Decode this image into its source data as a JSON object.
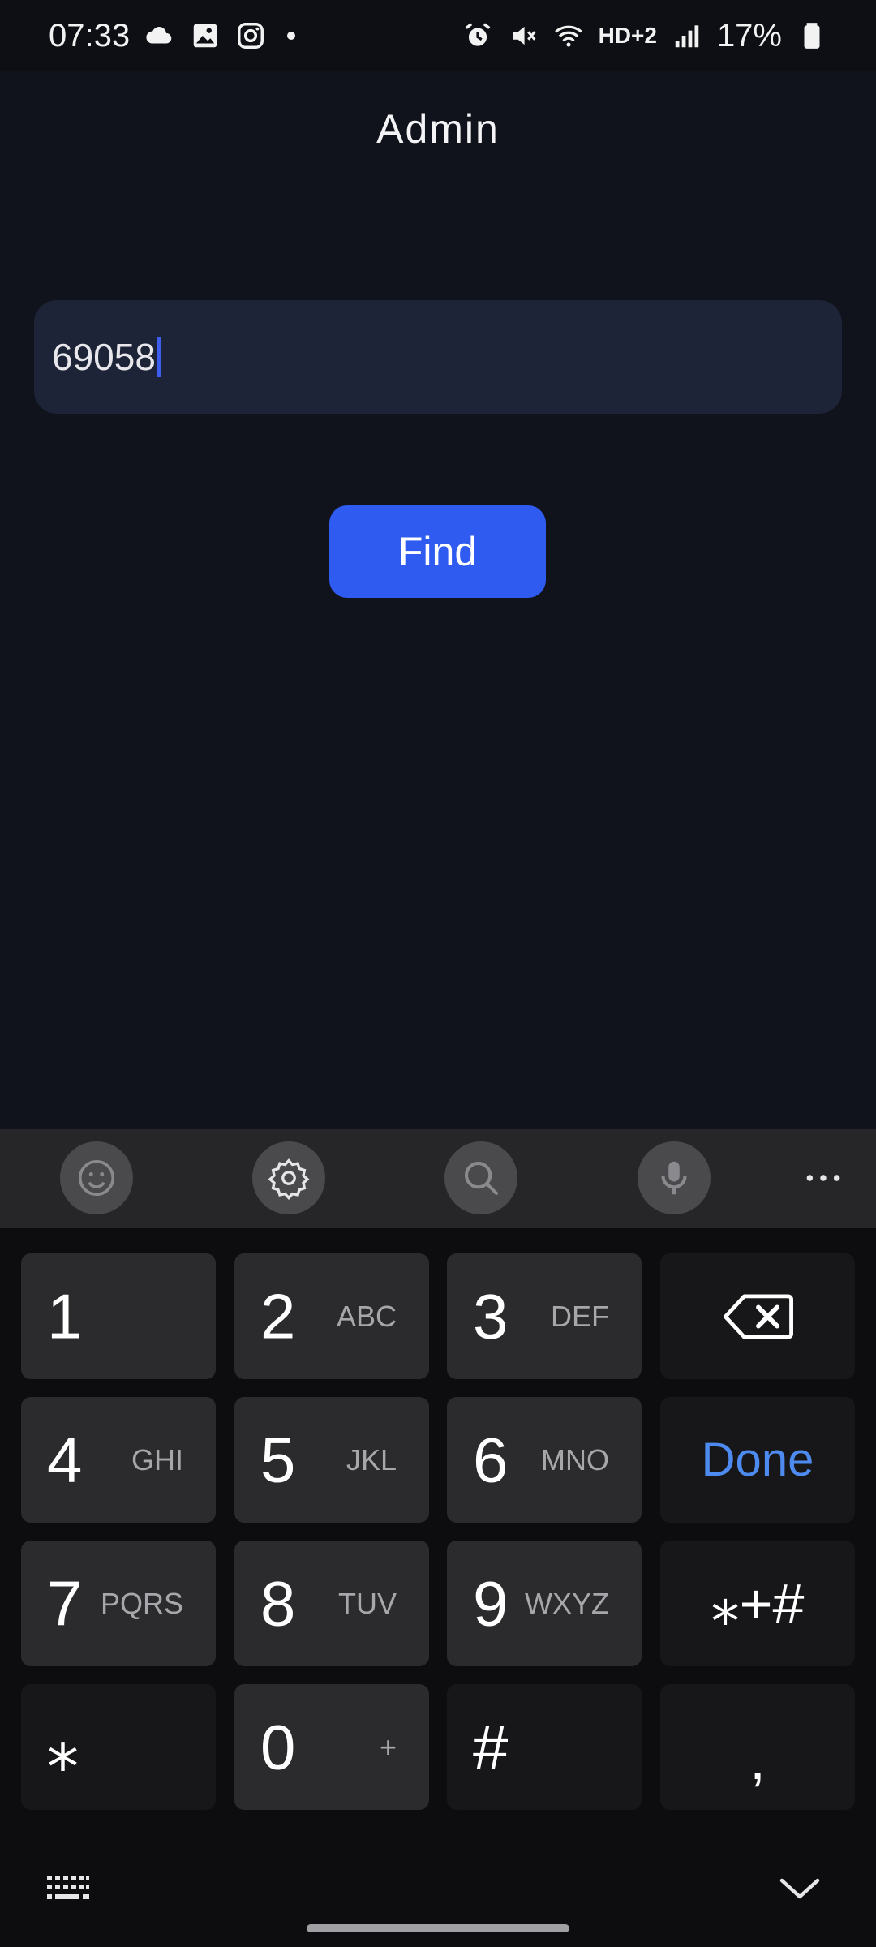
{
  "status_bar": {
    "time": "07:33",
    "battery": "17%",
    "hd_label": "HD+2",
    "left_icons": [
      "cloud-icon",
      "gallery-icon",
      "instagram-icon",
      "notification-dot"
    ],
    "right_icons": [
      "alarm-icon",
      "mute-icon",
      "wifi-icon",
      "hd-voice-icon",
      "signal-icon",
      "battery-icon"
    ]
  },
  "header": {
    "title": "Admin"
  },
  "search": {
    "value": "69058"
  },
  "find_button": {
    "label": "Find"
  },
  "keyboard": {
    "toolbar": [
      "emoji-icon",
      "settings-icon",
      "search-icon",
      "microphone-icon",
      "more-icon"
    ],
    "keys": {
      "k1": {
        "main": "1",
        "sub": ""
      },
      "k2": {
        "main": "2",
        "sub": "ABC"
      },
      "k3": {
        "main": "3",
        "sub": "DEF"
      },
      "k4": {
        "main": "4",
        "sub": "GHI"
      },
      "k5": {
        "main": "5",
        "sub": "JKL"
      },
      "k6": {
        "main": "6",
        "sub": "MNO"
      },
      "k7": {
        "main": "7",
        "sub": "PQRS"
      },
      "k8": {
        "main": "8",
        "sub": "TUV"
      },
      "k9": {
        "main": "9",
        "sub": "WXYZ"
      },
      "k0": {
        "main": "0",
        "sub": "+"
      },
      "star": "⁎",
      "hash": "#",
      "done": "Done",
      "symbols": "⁎+#",
      "comma": ","
    }
  },
  "colors": {
    "background": "#11131c",
    "field": "#1e2438",
    "accent": "#2f5bf1",
    "done_text": "#4e8bf1"
  }
}
